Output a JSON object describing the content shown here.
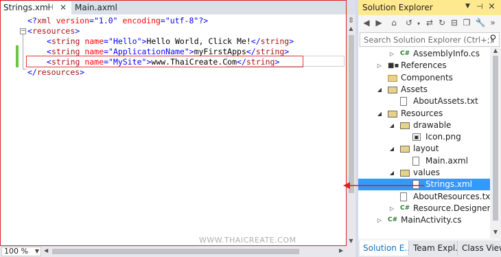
{
  "editor": {
    "tabs": [
      {
        "label": "Strings.xml",
        "active": true
      },
      {
        "label": "Main.axml",
        "active": false
      }
    ],
    "pin_glyph": "⊣",
    "close_glyph": "✕",
    "code": {
      "line1": [
        "<?",
        "xml",
        " version",
        "=\"",
        "1.0",
        "\"",
        " encoding",
        "=\"",
        "utf-8",
        "\"",
        "?>"
      ],
      "line2_open": "<",
      "line2_tag": "resources",
      "line2_close": ">",
      "line3": {
        "tag": "string",
        "attr": "name",
        "value": "Hello",
        "text": "Hello World, Click Me!"
      },
      "line4": {
        "tag": "string",
        "attr": "name",
        "value": "ApplicationName",
        "text": "myFirstApps"
      },
      "line5": {
        "tag": "string",
        "attr": "name",
        "value": "MySite",
        "text": "www.ThaiCreate.Com"
      },
      "line6_tag": "resources"
    },
    "watermark": "WWW.THAICREATE.COM",
    "zoom": "100 %"
  },
  "solution_explorer": {
    "title": "Solution Explorer",
    "search_placeholder": "Search Solution Explorer (Ctrl+;)",
    "tree": [
      {
        "label": "AssemblyInfo.cs",
        "icon": "csharp-file-icon",
        "indent": 3,
        "expander": "collapsed"
      },
      {
        "label": "References",
        "icon": "references-icon",
        "indent": 2,
        "expander": "collapsed"
      },
      {
        "label": "Components",
        "icon": "folder-icon",
        "indent": 2,
        "expander": "none"
      },
      {
        "label": "Assets",
        "icon": "folder-open-icon",
        "indent": 2,
        "expander": "expanded"
      },
      {
        "label": "AboutAssets.txt",
        "icon": "text-file-icon",
        "indent": 3,
        "expander": "none"
      },
      {
        "label": "Resources",
        "icon": "folder-open-icon",
        "indent": 2,
        "expander": "expanded"
      },
      {
        "label": "drawable",
        "icon": "folder-open-icon",
        "indent": 3,
        "expander": "expanded"
      },
      {
        "label": "Icon.png",
        "icon": "image-file-icon",
        "indent": 4,
        "expander": "none"
      },
      {
        "label": "layout",
        "icon": "folder-open-icon",
        "indent": 3,
        "expander": "expanded"
      },
      {
        "label": "Main.axml",
        "icon": "file-icon",
        "indent": 4,
        "expander": "none"
      },
      {
        "label": "values",
        "icon": "folder-open-icon",
        "indent": 3,
        "expander": "expanded"
      },
      {
        "label": "Strings.xml",
        "icon": "xml-file-icon",
        "indent": 4,
        "expander": "none",
        "selected": true
      },
      {
        "label": "AboutResources.txt",
        "icon": "text-file-icon",
        "indent": 3,
        "expander": "none"
      },
      {
        "label": "Resource.Designer.cs",
        "icon": "csharp-file-icon",
        "indent": 3,
        "expander": "collapsed"
      },
      {
        "label": "MainActivity.cs",
        "icon": "csharp-file-icon",
        "indent": 2,
        "expander": "collapsed"
      }
    ],
    "bottom_tabs": [
      {
        "label": "Solution E..."
      },
      {
        "label": "Team Expl..."
      },
      {
        "label": "Class View"
      }
    ]
  }
}
